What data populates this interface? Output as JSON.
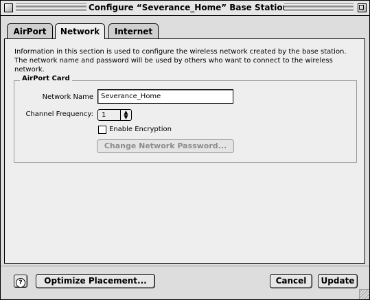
{
  "window": {
    "title": "Configure “Severance_Home” Base Station"
  },
  "tabs": [
    {
      "label": "AirPort",
      "active": false
    },
    {
      "label": "Network",
      "active": true
    },
    {
      "label": "Internet",
      "active": false
    }
  ],
  "network_panel": {
    "description": "Information in this section is used to configure the wireless network created by the base station. The network name and password will be used by others who want to connect to the wireless network.",
    "group_title": "AirPort Card",
    "network_name_label": "Network Name",
    "network_name_value": "Severance_Home",
    "channel_label": "Channel Frequency:",
    "channel_value": "1",
    "encryption_label": "Enable Encryption",
    "encryption_checked": false,
    "change_password_label": "Change Network Password..."
  },
  "footer": {
    "help_icon": "question-mark-icon",
    "help_glyph": "?",
    "optimize_label": "Optimize Placement...",
    "cancel_label": "Cancel",
    "update_label": "Update"
  }
}
